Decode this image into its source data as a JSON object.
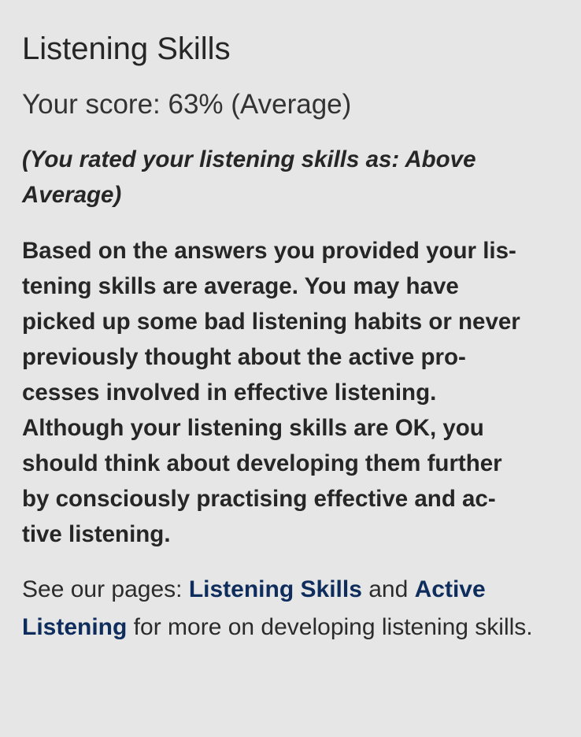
{
  "result": {
    "title": "Listening Skills",
    "score_text": "Your score: 63% (Average)",
    "self_rating_text": "(You rated your listening skills as: Above Average)",
    "feedback_lines": [
      "Based on the answers you provided your lis-",
      "tening skills are average.  You may have",
      "picked up some bad listening habits or never",
      "previously thought about the active pro-",
      "cesses involved in effective listening.",
      "Although your listening skills are OK, you",
      "should think about developing them further",
      "by consciously practising effective and ac-",
      "tive listening."
    ],
    "see_also": {
      "prefix": "See our pages: ",
      "link1_label": "Listening Skills",
      "joiner": " and ",
      "link2_label": "Active Listening",
      "suffix": " for more on developing listening skills."
    }
  },
  "colors": {
    "background": "#e6e6e6",
    "text": "#262626",
    "link": "#0f2d5c"
  }
}
